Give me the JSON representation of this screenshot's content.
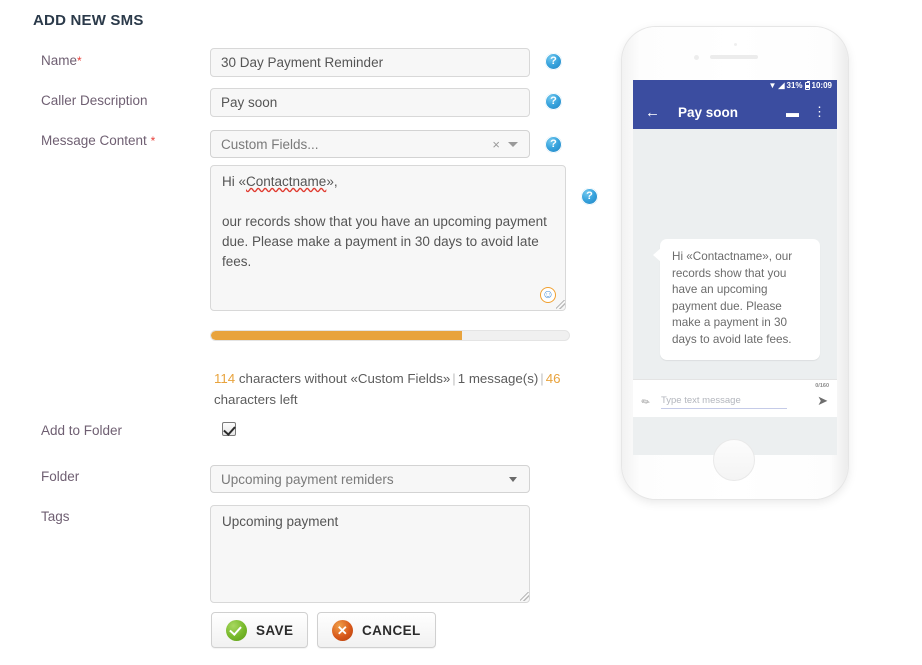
{
  "form": {
    "title": "ADD NEW SMS",
    "fields": {
      "name": {
        "label": "Name",
        "required_mark": "*",
        "value": "30 Day Payment Reminder",
        "help": "?"
      },
      "caller_description": {
        "label": "Caller Description",
        "value": "Pay soon",
        "help": "?"
      },
      "message_content": {
        "label": "Message Content",
        "required_mark": "*",
        "custom_fields_value": "Custom Fields...",
        "clear_icon": "×",
        "help": "?",
        "message_line1": "Hi «Contactname»,",
        "message_spell_word": "Contactname",
        "message_body": "our records show that you have an upcoming payment due. Please make a payment in 30 days to avoid late fees.",
        "emoji_icon": "☺"
      },
      "add_to_folder": {
        "label": "Add to Folder",
        "checked": true
      },
      "folder": {
        "label": "Folder",
        "value": "Upcoming payment remiders"
      },
      "tags": {
        "label": "Tags",
        "value": "Upcoming payment"
      }
    },
    "counter": {
      "char_count": "114",
      "char_text": " characters without «Custom Fields»",
      "separator": "|",
      "messages": "1 message(s)",
      "left_count": "46",
      "left_text": " characters left",
      "progress_percent": 70,
      "progress_color": "#e8a33d"
    },
    "buttons": {
      "save": "SAVE",
      "cancel": "CANCEL",
      "cancel_icon": "✕"
    }
  },
  "phone": {
    "status": {
      "wifi": "▼",
      "signal": "◢",
      "battery_percent": "31%",
      "time": "10:09"
    },
    "appbar": {
      "back_icon": "←",
      "title": "Pay soon",
      "chat_icon": "▬",
      "more_icon": "⋮"
    },
    "message": "Hi «Contactname», our records show that you have an upcoming payment due. Please make a payment in 30 days to avoid late fees.",
    "input": {
      "counter": "0/160",
      "attach_icon": "✎",
      "placeholder": "Type text message",
      "send_icon": "➤"
    },
    "colors": {
      "appbar": "#3b4da0",
      "screen_bg": "#eceff0",
      "bubble_bg": "#ffffff"
    }
  }
}
